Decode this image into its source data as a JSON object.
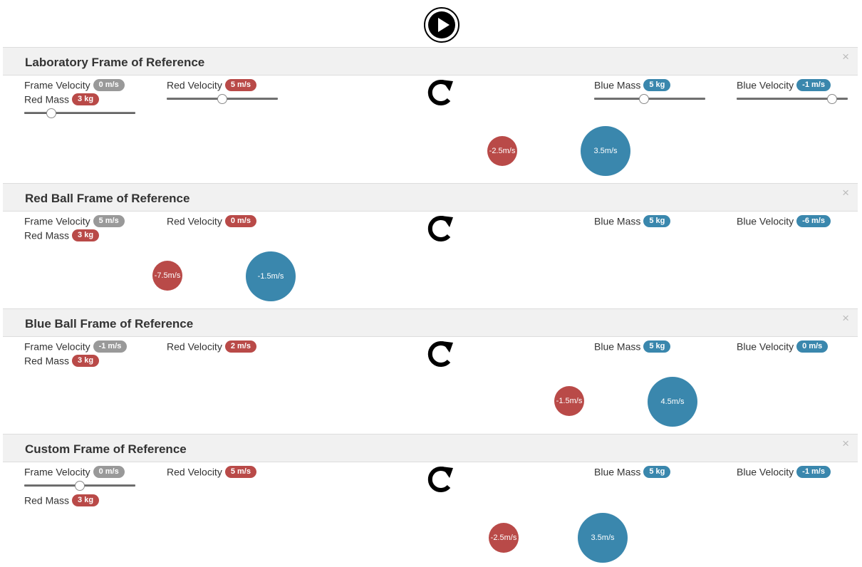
{
  "colors": {
    "red": "#b94a48",
    "blue": "#3a87ad",
    "gray": "#999999",
    "header_bg": "#f1f1f1"
  },
  "play_icon": "play-circle-icon",
  "panels": [
    {
      "title": "Laboratory Frame of Reference",
      "close": "×",
      "frame_velocity": {
        "label": "Frame Velocity",
        "value": "0 m/s"
      },
      "red_mass": {
        "label": "Red Mass",
        "value": "3 kg"
      },
      "red_velocity": {
        "label": "Red Velocity",
        "value": "5 m/s"
      },
      "blue_mass": {
        "label": "Blue Mass",
        "value": "5 kg"
      },
      "blue_velocity": {
        "label": "Blue Velocity",
        "value": "-1 m/s"
      },
      "red_ball": "-2.5m/s",
      "blue_ball": "3.5m/s"
    },
    {
      "title": "Red Ball Frame of Reference",
      "close": "×",
      "frame_velocity": {
        "label": "Frame Velocity",
        "value": "5 m/s"
      },
      "red_mass": {
        "label": "Red Mass",
        "value": "3 kg"
      },
      "red_velocity": {
        "label": "Red Velocity",
        "value": "0 m/s"
      },
      "blue_mass": {
        "label": "Blue Mass",
        "value": "5 kg"
      },
      "blue_velocity": {
        "label": "Blue Velocity",
        "value": "-6 m/s"
      },
      "red_ball": "-7.5m/s",
      "blue_ball": "-1.5m/s"
    },
    {
      "title": "Blue Ball Frame of Reference",
      "close": "×",
      "frame_velocity": {
        "label": "Frame Velocity",
        "value": "-1 m/s"
      },
      "red_mass": {
        "label": "Red Mass",
        "value": "3 kg"
      },
      "red_velocity": {
        "label": "Red Velocity",
        "value": "2 m/s"
      },
      "blue_mass": {
        "label": "Blue Mass",
        "value": "5 kg"
      },
      "blue_velocity": {
        "label": "Blue Velocity",
        "value": "0 m/s"
      },
      "red_ball": "-1.5m/s",
      "blue_ball": "4.5m/s"
    },
    {
      "title": "Custom Frame of Reference",
      "close": "×",
      "frame_velocity": {
        "label": "Frame Velocity",
        "value": "0 m/s"
      },
      "red_mass": {
        "label": "Red Mass",
        "value": "3 kg"
      },
      "red_velocity": {
        "label": "Red Velocity",
        "value": "5 m/s"
      },
      "blue_mass": {
        "label": "Blue Mass",
        "value": "5 kg"
      },
      "blue_velocity": {
        "label": "Blue Velocity",
        "value": "-1 m/s"
      },
      "red_ball": "-2.5m/s",
      "blue_ball": "3.5m/s"
    }
  ]
}
